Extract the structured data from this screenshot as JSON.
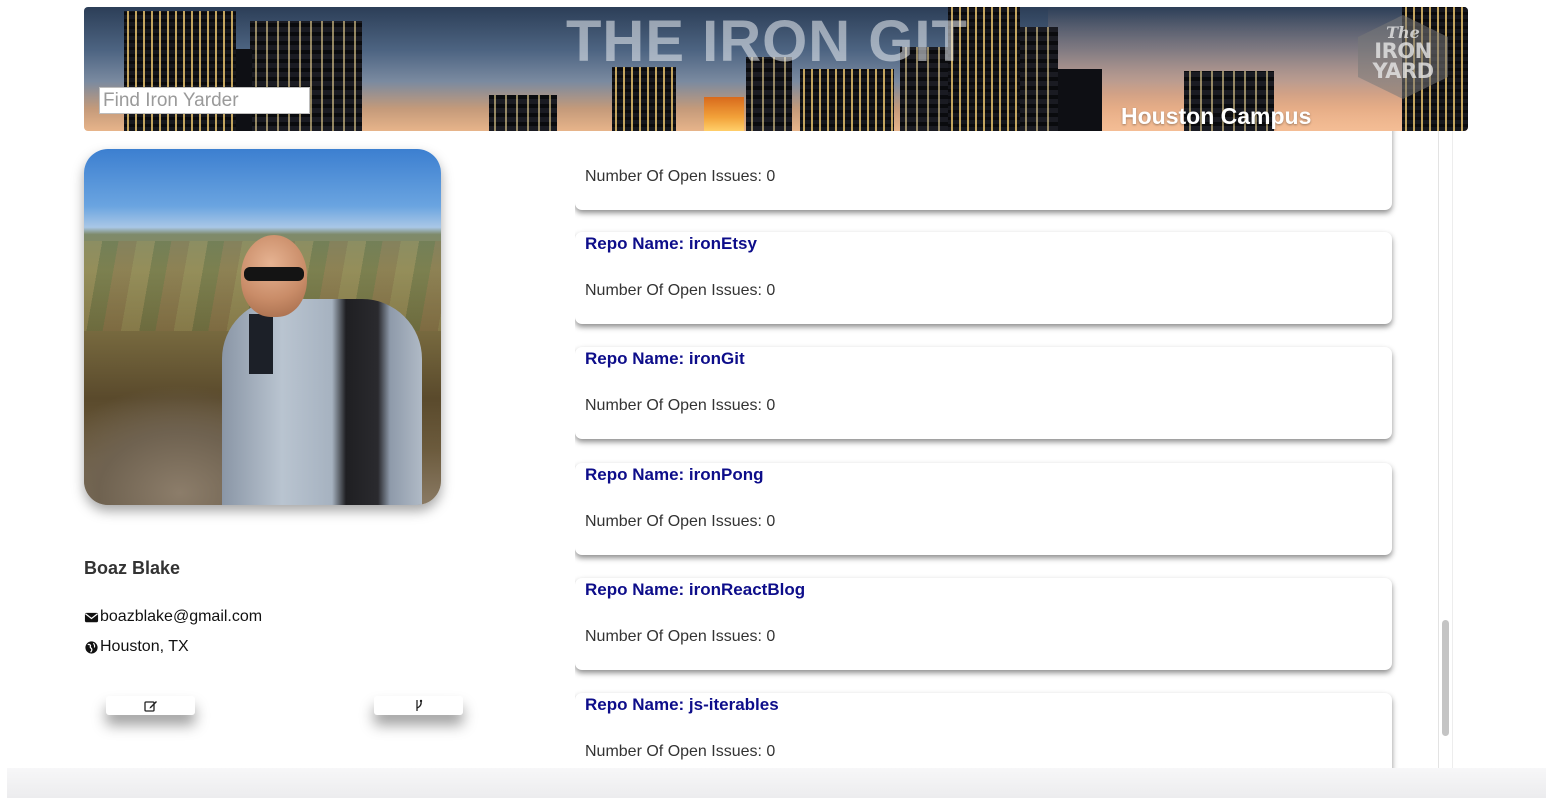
{
  "header": {
    "title": "THE IRON GIT",
    "search": {
      "placeholder": "Find Iron Yarder",
      "value": ""
    },
    "campus": "Houston Campus",
    "logo": {
      "line1": "The",
      "line2": "IRON",
      "line3": "YARD"
    }
  },
  "profile": {
    "name": "Boaz Blake",
    "email": "boazblake@gmail.com",
    "location": "Houston, TX",
    "email_icon": "envelope-icon",
    "location_icon": "globe-icon",
    "edit_icon": "edit-icon",
    "fork_icon": "fork-icon"
  },
  "repos": {
    "name_prefix": "Repo Name: ",
    "issues_prefix": "Number Of Open Issues: ",
    "items": [
      {
        "name": "",
        "issues": "Number Of Open Issues: 0",
        "name_partially_hidden": true
      },
      {
        "name": "Repo Name: ironEtsy",
        "issues": "Number Of Open Issues: 0"
      },
      {
        "name": "Repo Name: ironGit",
        "issues": "Number Of Open Issues: 0"
      },
      {
        "name": "Repo Name: ironPong",
        "issues": "Number Of Open Issues: 0"
      },
      {
        "name": "Repo Name: ironReactBlog",
        "issues": "Number Of Open Issues: 0"
      },
      {
        "name": "Repo Name: js-iterables",
        "issues": "Number Of Open Issues: 0"
      }
    ]
  },
  "colors": {
    "repo_name": "#0d0d8a",
    "text": "#333333",
    "background": "#ffffff"
  }
}
